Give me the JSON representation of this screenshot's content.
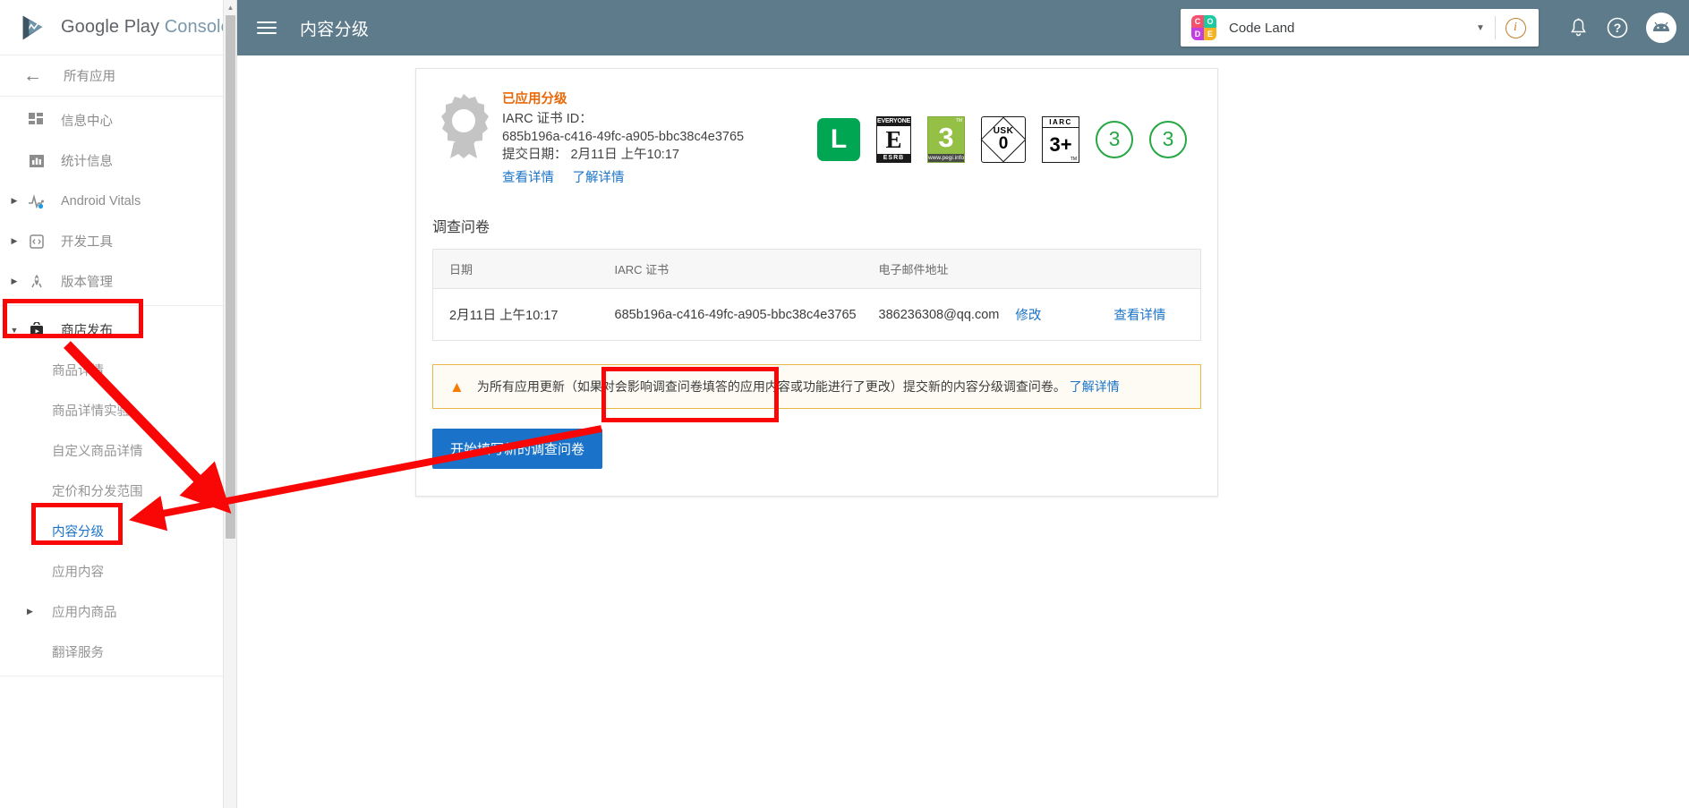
{
  "sidebar": {
    "brand": {
      "google_play": "Google Play",
      "console": "Console"
    },
    "back": {
      "label": "所有应用",
      "icon": "arrow-left-icon"
    },
    "items": [
      {
        "label": "信息中心",
        "icon": "dashboard-icon",
        "caret": "",
        "expandable": false
      },
      {
        "label": "统计信息",
        "icon": "bar-chart-icon",
        "caret": "",
        "expandable": false
      },
      {
        "label": "Android Vitals",
        "icon": "pulse-icon",
        "caret": "▶",
        "expandable": true
      },
      {
        "label": "开发工具",
        "icon": "code-icon",
        "caret": "▶",
        "expandable": true
      },
      {
        "label": "版本管理",
        "icon": "rocket-icon",
        "caret": "▶",
        "expandable": true
      },
      {
        "label": "商店发布",
        "icon": "store-icon",
        "caret": "▼",
        "expandable": true,
        "expanded": true,
        "highlighted": true
      }
    ],
    "sub_items": [
      {
        "label": "商品详情",
        "active": false,
        "caret": ""
      },
      {
        "label": "商品详情实验",
        "active": false,
        "caret": ""
      },
      {
        "label": "自定义商品详情",
        "active": false,
        "caret": ""
      },
      {
        "label": "定价和分发范围",
        "active": false,
        "caret": ""
      },
      {
        "label": "内容分级",
        "active": true,
        "caret": "",
        "highlighted": true
      },
      {
        "label": "应用内容",
        "active": false,
        "caret": ""
      },
      {
        "label": "应用内商品",
        "active": false,
        "caret": "▶"
      },
      {
        "label": "翻译服务",
        "active": false,
        "caret": ""
      }
    ]
  },
  "topbar": {
    "menu_icon": "hamburger-icon",
    "title": "内容分级",
    "app_selector": {
      "app_name": "Code Land",
      "icon_letters": [
        "C",
        "O",
        "D",
        "E"
      ],
      "icon_colors": [
        "#f4516c",
        "#1ec9a0",
        "#c23ee0",
        "#f5b324"
      ],
      "caret": "▼"
    },
    "icons": {
      "info": "info-icon",
      "notifications": "bell-icon",
      "help": "help-icon",
      "account": "android-avatar-icon"
    }
  },
  "card": {
    "rating": {
      "medal_icon": "award-ribbon-icon",
      "status": "已应用分级",
      "cert_label": "IARC 证书 ID：",
      "cert_id": "685b196a-c416-49fc-a905-bbc38c4e3765",
      "submit_date": "提交日期： 2月11日 上午10:17",
      "links": [
        "查看详情",
        "了解详情"
      ]
    },
    "badges": [
      {
        "type": "classind",
        "value": "L"
      },
      {
        "type": "esrb",
        "top": "EVERYONE",
        "value": "E",
        "bottom": "ESRB"
      },
      {
        "type": "pegi",
        "value": "3",
        "url": "www.pegi.info",
        "tm": "TM"
      },
      {
        "type": "usk",
        "label": "USK",
        "value": "0"
      },
      {
        "type": "iarc",
        "top": "IARC",
        "value": "3+",
        "tm": "TM"
      },
      {
        "type": "circle",
        "value": "3"
      },
      {
        "type": "circle",
        "value": "3"
      }
    ],
    "section_title": "调查问卷",
    "table": {
      "headers": [
        "日期",
        "IARC 证书",
        "电子邮件地址",
        "",
        ""
      ],
      "rows": [
        {
          "date": "2月11日 上午10:17",
          "cert": "685b196a-c416-49fc-a905-bbc38c4e3765",
          "email": "386236308@qq.com",
          "edit_link": "修改",
          "detail_link": "查看详情"
        }
      ]
    },
    "warning": {
      "icon": "warning-triangle-icon",
      "text": "为所有应用更新（如果对会影响调查问卷填答的应用内容或功能进行了更改）提交新的内容分级调查问卷。",
      "link": "了解详情"
    },
    "cta_button": "开始填写新的调查问卷"
  },
  "colors": {
    "header_bg": "#5d7b8a",
    "accent_blue": "#1a73c9",
    "status_orange": "#e8690b",
    "annotation_red": "#f90707",
    "warning_border": "#e8b84b"
  }
}
